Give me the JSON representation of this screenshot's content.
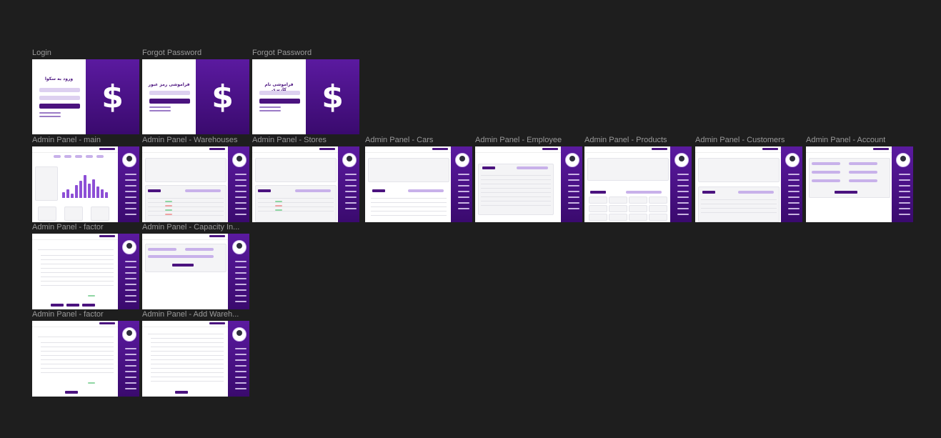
{
  "canvas": {
    "background": "#1e1e1e"
  },
  "accent": "#4b137f",
  "frames": {
    "login": {
      "label": "Login",
      "heading": "ورود به سکوا"
    },
    "forgot_password_1": {
      "label": "Forgot Password",
      "heading": "فراموشی رمز عبور"
    },
    "forgot_password_2": {
      "label": "Forgot Password",
      "heading": "فراموشی نام کاربری"
    },
    "admin_main": {
      "label": "Admin Panel - main"
    },
    "admin_warehouses": {
      "label": "Admin Panel - Warehouses"
    },
    "admin_stores": {
      "label": "Admin Panel - Stores"
    },
    "admin_cars": {
      "label": "Admin Panel - Cars"
    },
    "admin_employee": {
      "label": "Admin Panel - Employee"
    },
    "admin_products": {
      "label": "Admin Panel - Products"
    },
    "admin_customers": {
      "label": "Admin Panel - Customers"
    },
    "admin_account": {
      "label": "Admin Panel - Account"
    },
    "admin_factor_1": {
      "label": "Admin Panel - factor"
    },
    "admin_capacity": {
      "label": "Admin Panel - Capacity In..."
    },
    "admin_factor_2": {
      "label": "Admin Panel - factor"
    },
    "admin_add_warehouse": {
      "label": "Admin Panel - Add Wareh..."
    }
  },
  "icons": {
    "brand": "dollar-sign-icon"
  },
  "brand_symbol": "$"
}
